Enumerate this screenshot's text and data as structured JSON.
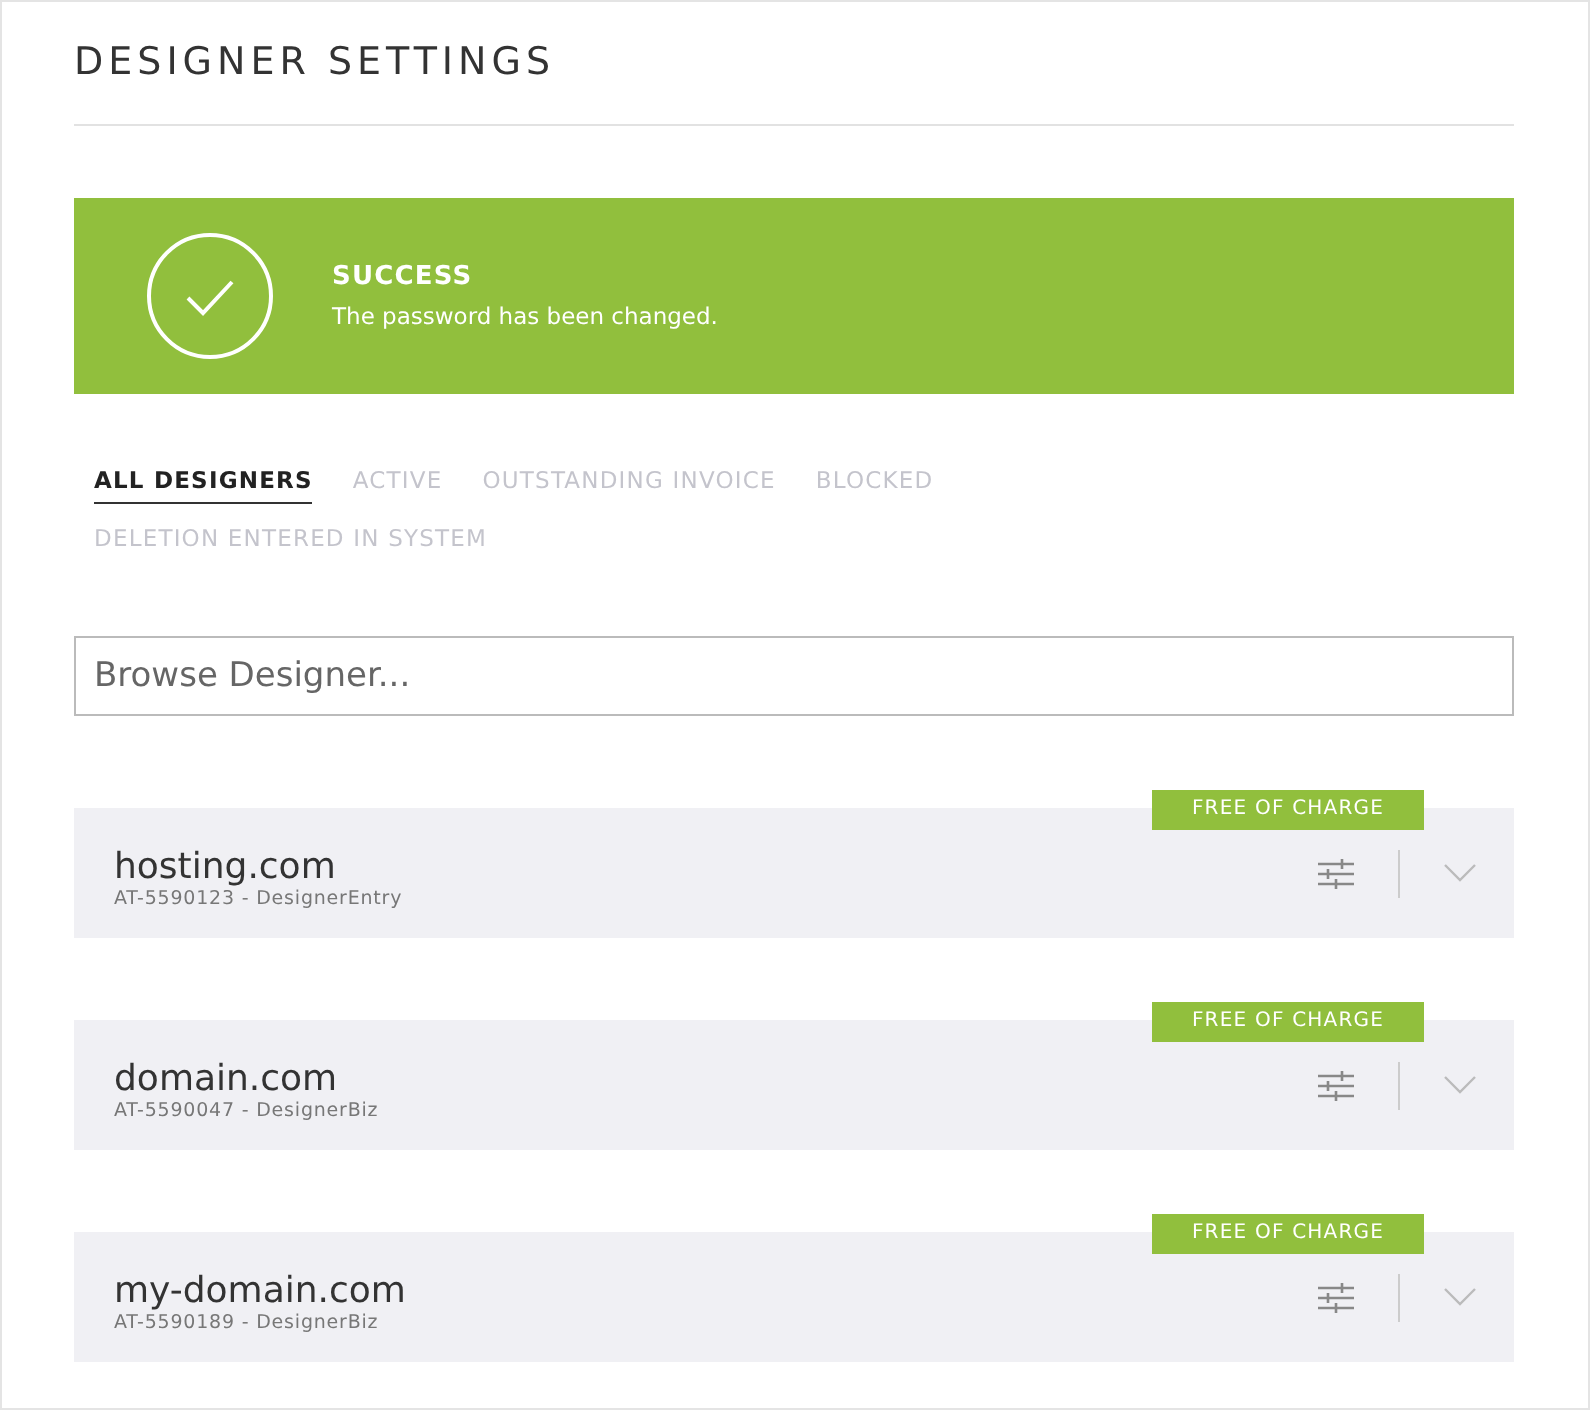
{
  "page": {
    "title": "DESIGNER SETTINGS"
  },
  "alert": {
    "heading": "SUCCESS",
    "message": "The password has been changed."
  },
  "tabs": [
    {
      "label": "ALL DESIGNERS",
      "selected": true
    },
    {
      "label": "ACTIVE",
      "selected": false
    },
    {
      "label": "OUTSTANDING INVOICE",
      "selected": false
    },
    {
      "label": "BLOCKED",
      "selected": false
    },
    {
      "label": "DELETION ENTERED IN SYSTEM",
      "selected": false
    }
  ],
  "search": {
    "placeholder": "Browse Designer..."
  },
  "designers": [
    {
      "domain": "hosting.com",
      "details": "AT-5590123 - DesignerEntry",
      "badge": "FREE OF CHARGE"
    },
    {
      "domain": "domain.com",
      "details": "AT-5590047 - DesignerBiz",
      "badge": "FREE OF CHARGE"
    },
    {
      "domain": "my-domain.com",
      "details": "AT-5590189 - DesignerBiz",
      "badge": "FREE OF CHARGE"
    }
  ]
}
